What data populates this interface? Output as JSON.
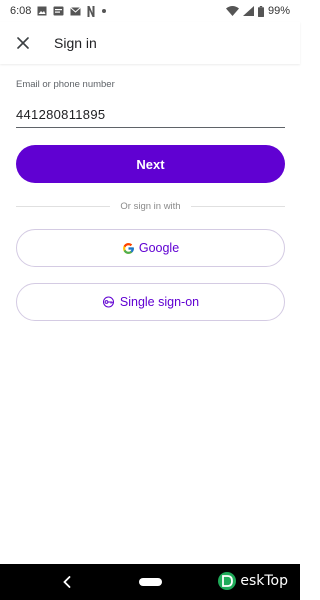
{
  "status_bar": {
    "time": "6:08",
    "notification_icons": [
      "image-icon",
      "notification-badge-icon",
      "mail-icon",
      "netflix-icon",
      "dot-icon"
    ],
    "battery": "99%"
  },
  "app_bar": {
    "title": "Sign in"
  },
  "form": {
    "email_label": "Email or phone number",
    "email_value": "441280811895",
    "next_label": "Next",
    "divider_text": "Or sign in with",
    "google_label": "Google",
    "sso_label": "Single sign-on"
  },
  "colors": {
    "brand": "#6001d2",
    "outline": "#d4cbe3"
  },
  "watermark": {
    "text": "eskTop"
  }
}
